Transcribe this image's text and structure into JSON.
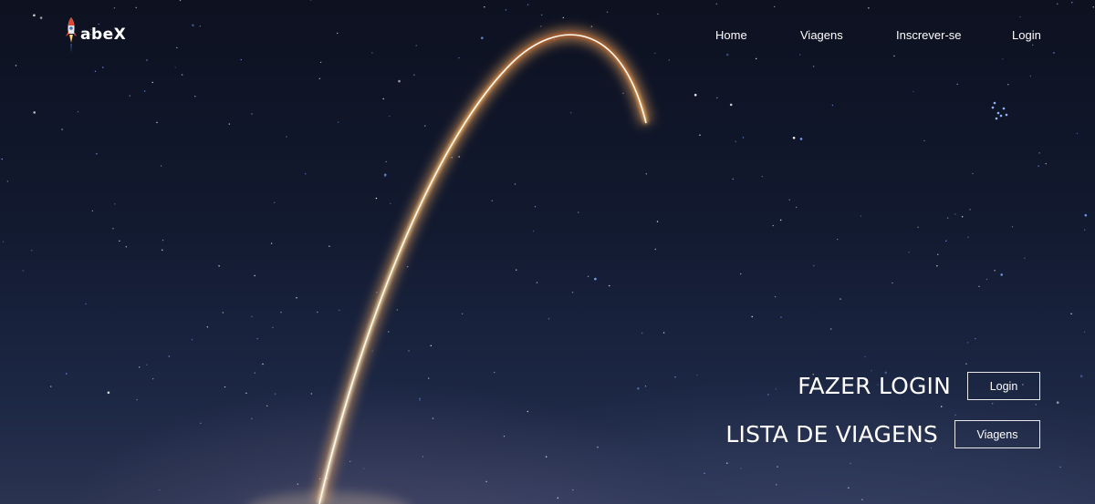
{
  "brand": {
    "name": "abeX",
    "icon": "rocket-icon"
  },
  "nav": {
    "items": [
      {
        "label": "Home"
      },
      {
        "label": "Viagens"
      },
      {
        "label": "Inscrever-se"
      },
      {
        "label": "Login"
      }
    ]
  },
  "hero": {
    "background": "starry night sky with rocket launch trail",
    "login_title": "FAZER LOGIN",
    "login_button": "Login",
    "trips_title": "LISTA DE VIAGENS",
    "trips_button": "Viagens"
  },
  "colors": {
    "sky_top": "#0d1120",
    "sky_bottom": "#2a3350",
    "trail": "#ffd79a",
    "text": "#ffffff"
  }
}
